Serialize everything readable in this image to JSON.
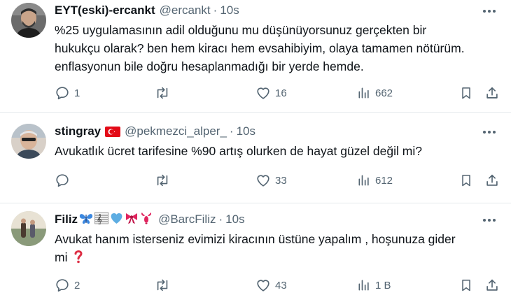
{
  "tweets": [
    {
      "name": "EYT(eski)-ercankt",
      "handle": "@ercankt",
      "separator": "·",
      "time": "10s",
      "lines": [
        "%25 uygulamasının adil olduğunu mu düşünüyorsunuz gerçekten bir",
        "hukukçu olarak? ben hem kiracı hem evsahibiyim, olaya tamamen nötürüm.",
        "enflasyonun bile doğru hesaplanmadığı bir yerde hemde."
      ],
      "replies": "1",
      "retweets": "",
      "likes": "16",
      "views": "662"
    },
    {
      "name": "stingray",
      "handle": "@pekmezci_alper_",
      "separator": "·",
      "time": "10s",
      "lines": [
        "Avukatlık ücret tarifesine %90 artış olurken de hayat güzel değil mi?"
      ],
      "replies": "",
      "retweets": "",
      "likes": "33",
      "views": "612"
    },
    {
      "name": "Filiz",
      "name_emojis": [
        "butterfly-icon",
        "music-score-icon",
        "blue-heart-icon",
        "ribbon-icon",
        "lobster-icon"
      ],
      "handle": "@BarcFiliz",
      "separator": "·",
      "time": "10s",
      "lines": [
        "Avukat hanım isterseniz evimizi kiracının üstüne yapalım , hoşunuza gider",
        "mi"
      ],
      "trailing_emoji": "red-question-mark-icon",
      "replies": "2",
      "retweets": "",
      "likes": "43",
      "views": "1 B"
    }
  ],
  "icons": {
    "more": "more-icon",
    "reply": "reply-icon",
    "retweet": "retweet-icon",
    "like": "like-icon",
    "views": "views-icon",
    "bookmark": "bookmark-icon",
    "share": "share-icon"
  },
  "colors": {
    "text": "#0f1419",
    "secondary": "#536471",
    "divider": "#e5e9ec",
    "flag_red": "#e30a17"
  }
}
